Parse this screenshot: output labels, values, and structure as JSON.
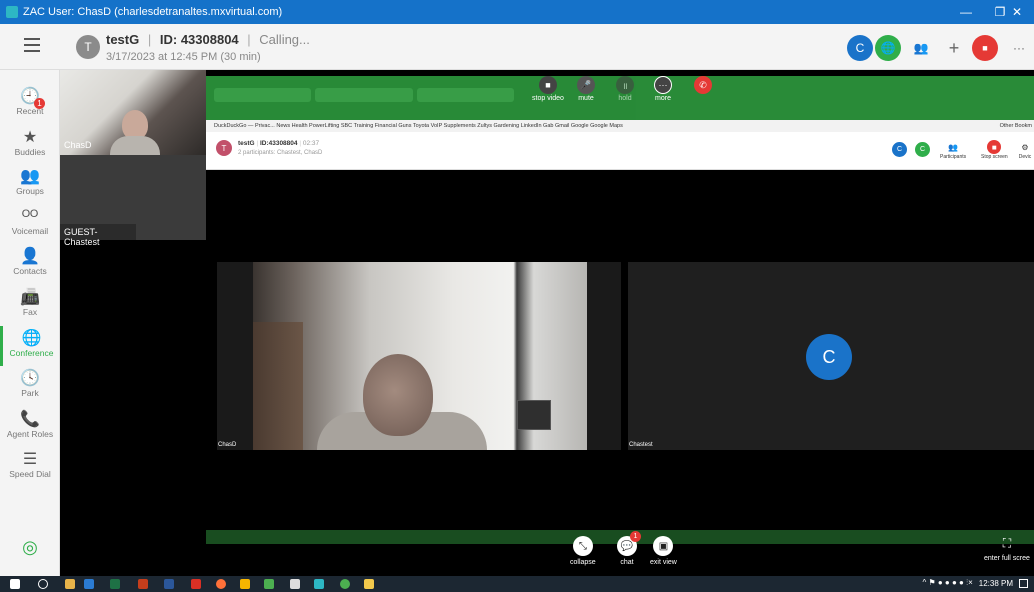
{
  "window": {
    "title": "ZAC User: ChasD (charlesdetranaltes.mxvirtual.com)",
    "minimize": "—",
    "restore": "❐",
    "close": "✕"
  },
  "header": {
    "avatar_initial": "T",
    "name": "testG",
    "sep": "|",
    "id_label": "ID: 43308804",
    "status": "Calling...",
    "datetime": "3/17/2023 at 12:45 PM (30 min)",
    "buttons": {
      "participant_initial": "C",
      "conference_icon": "🌐",
      "add_user_icon": "👥",
      "add_icon": "+",
      "end_icon": "■",
      "more_icon": "···"
    }
  },
  "sidebar": {
    "items": [
      {
        "label": "Recent",
        "icon": "🕘",
        "badge": "1"
      },
      {
        "label": "Buddies",
        "icon": "★"
      },
      {
        "label": "Groups",
        "icon": "👥"
      },
      {
        "label": "Voicemail",
        "icon": "ᴼᴼ"
      },
      {
        "label": "Contacts",
        "icon": "👤"
      },
      {
        "label": "Fax",
        "icon": "📠"
      },
      {
        "label": "Conference",
        "icon": "🌐"
      },
      {
        "label": "Park",
        "icon": "🕓"
      },
      {
        "label": "Agent Roles",
        "icon": "📞"
      },
      {
        "label": "Speed Dial",
        "icon": "☰"
      }
    ],
    "location_icon": "◎"
  },
  "left_panel": {
    "self_label": "ChasD",
    "guest_label": "GUEST-Chastest"
  },
  "share": {
    "top_controls": [
      {
        "label": "stop video",
        "icon": "■"
      },
      {
        "label": "mute",
        "icon": "🎤"
      },
      {
        "label": "hold",
        "icon": "॥"
      },
      {
        "label": "more",
        "icon": "···"
      },
      {
        "label": "",
        "icon": "✆"
      }
    ],
    "bookmarks": "DuckDuckGo — Privac...   News   Health   PowerLifting   SBC Training   Financial   Guns   Toyota   VoIP   Supplements   Zultys   Gardening   LinkedIn   Gab   Gmail   Google   Google Maps",
    "other_bookmarks": "Other Bookm",
    "inner": {
      "avatar_initial": "T",
      "title": "testG",
      "id": "ID:43308804",
      "time": "02:37",
      "participants": "2 participants: Chastest, ChasD",
      "avatar1": "C",
      "avatar2": "C",
      "tools": [
        {
          "label": "Participants",
          "icon": "👥"
        },
        {
          "label": "Stop screen",
          "icon": "■"
        },
        {
          "label": "Devic",
          "icon": "⚙"
        }
      ]
    },
    "tile_self_label": "ChasD",
    "tile_other_label": "Chastest",
    "tile_other_initial": "C",
    "bottom_controls": [
      {
        "label": "collapse",
        "icon": "⤡"
      },
      {
        "label": "chat",
        "icon": "💬",
        "badge": "1"
      },
      {
        "label": "exit view",
        "icon": "▣"
      }
    ],
    "fullscreen": {
      "label": "enter full scree",
      "icon": "⛶"
    }
  },
  "taskbar": {
    "time": "12:38 PM",
    "tray_icons": "^ ⚑ ● ● ● ● ⫶× "
  },
  "colors": {
    "titlebar": "#1572c9",
    "accent": "#2fae4a",
    "end_call": "#e53935",
    "avatar_blue": "#1a73c9"
  }
}
